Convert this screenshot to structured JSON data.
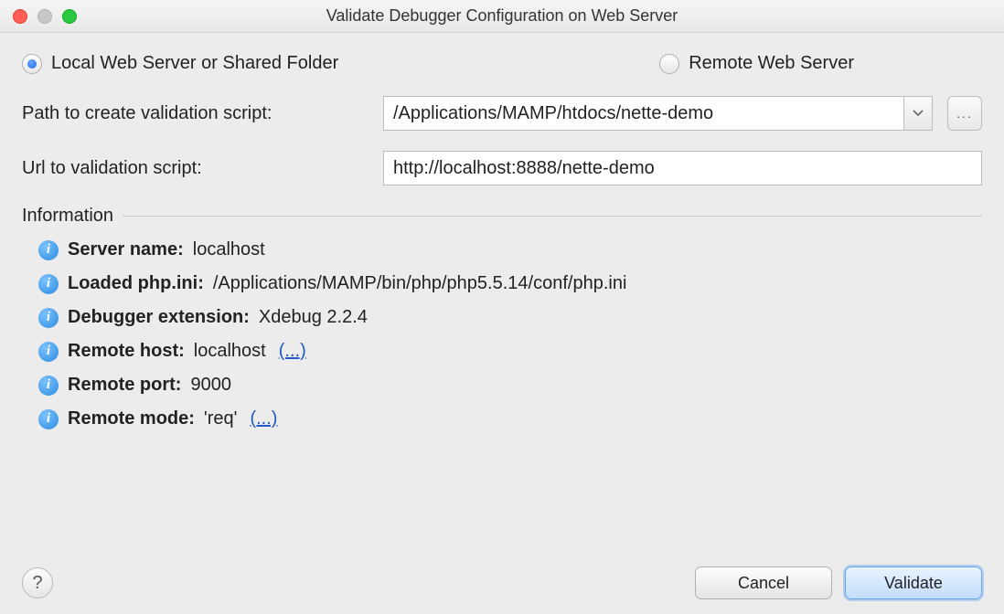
{
  "window": {
    "title": "Validate Debugger Configuration on Web Server"
  },
  "radios": {
    "local_label": "Local Web Server or Shared Folder",
    "remote_label": "Remote Web Server",
    "selected": "local"
  },
  "form": {
    "path_label": "Path to create validation script:",
    "path_value": "/Applications/MAMP/htdocs/nette-demo",
    "url_label": "Url to validation script:",
    "url_value": "http://localhost:8888/nette-demo"
  },
  "section": {
    "title": "Information"
  },
  "info": [
    {
      "label": "Server name:",
      "value": "localhost",
      "link": null
    },
    {
      "label": "Loaded php.ini:",
      "value": "/Applications/MAMP/bin/php/php5.5.14/conf/php.ini",
      "link": null
    },
    {
      "label": "Debugger extension:",
      "value": "Xdebug 2.2.4",
      "link": null
    },
    {
      "label": "Remote host:",
      "value": "localhost",
      "link": "(...)"
    },
    {
      "label": "Remote port:",
      "value": "9000",
      "link": null
    },
    {
      "label": "Remote mode:",
      "value": "'req'",
      "link": "(...)"
    }
  ],
  "buttons": {
    "cancel": "Cancel",
    "validate": "Validate",
    "browse": "...",
    "help": "?"
  }
}
